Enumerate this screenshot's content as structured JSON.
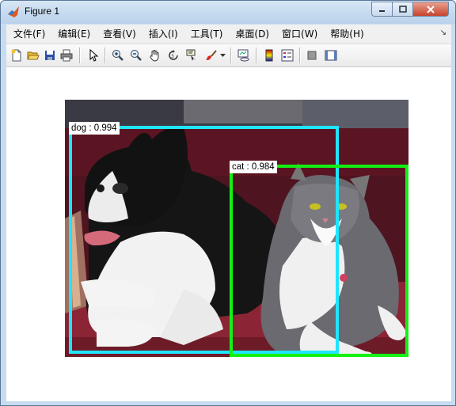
{
  "window": {
    "title": "Figure 1"
  },
  "menu": {
    "items": [
      "文件(F)",
      "编辑(E)",
      "查看(V)",
      "插入(I)",
      "工具(T)",
      "桌面(D)",
      "窗口(W)",
      "帮助(H)"
    ]
  },
  "toolbar": {
    "buttons": [
      {
        "icon": "new-figure-icon"
      },
      {
        "icon": "open-file-icon"
      },
      {
        "icon": "save-icon"
      },
      {
        "icon": "print-icon"
      },
      {
        "icon": "edit-plot-arrow-icon"
      },
      {
        "icon": "zoom-in-icon"
      },
      {
        "icon": "zoom-out-icon"
      },
      {
        "icon": "pan-hand-icon"
      },
      {
        "icon": "rotate-3d-icon"
      },
      {
        "icon": "data-cursor-icon"
      },
      {
        "icon": "brush-icon"
      },
      {
        "icon": "link-plot-icon"
      },
      {
        "icon": "colorbar-icon"
      },
      {
        "icon": "legend-icon"
      },
      {
        "icon": "hide-plot-tools-icon"
      },
      {
        "icon": "show-plot-tools-icon"
      }
    ]
  },
  "detections": [
    {
      "label": "dog : 0.994",
      "color": "#1fe5ff"
    },
    {
      "label": "cat : 0.984",
      "color": "#14f014"
    }
  ],
  "colors": {
    "dog_box": "#1fe5ff",
    "cat_box": "#14f014",
    "sofa": "#7a1c28"
  }
}
